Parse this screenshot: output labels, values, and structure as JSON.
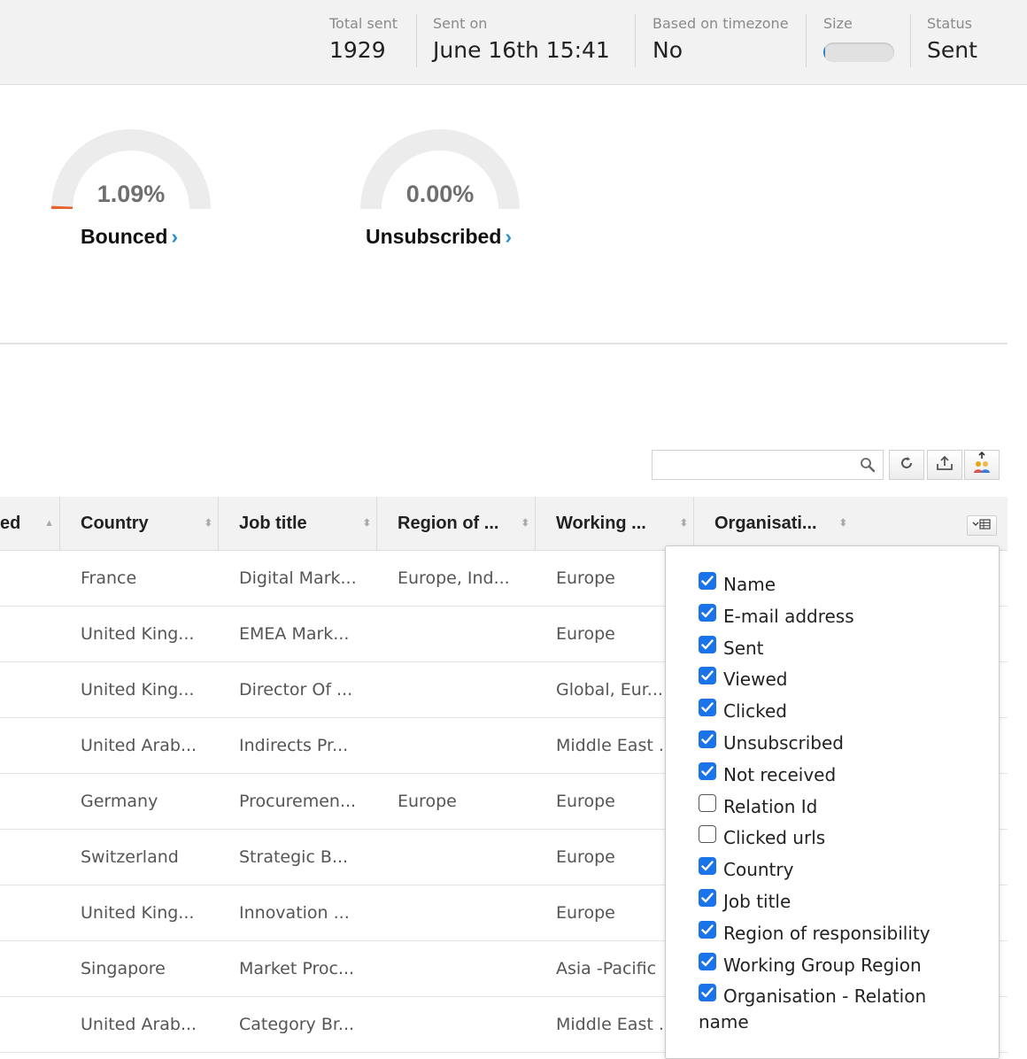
{
  "stats": {
    "total_sent": {
      "label": "Total sent",
      "value": "1929"
    },
    "sent_on": {
      "label": "Sent on",
      "value": "June 16th 15:41"
    },
    "timezone": {
      "label": "Based on timezone",
      "value": "No"
    },
    "size": {
      "label": "Size",
      "fill_fraction": 0.02
    },
    "status": {
      "label": "Status",
      "value": "Sent"
    }
  },
  "gauges": [
    {
      "percent_text": "1.09%",
      "fraction": 0.0109,
      "label": "Bounced",
      "chevron": "›",
      "accent": "#e8622c"
    },
    {
      "percent_text": "0.00%",
      "fraction": 0.0,
      "label": "Unsubscribed",
      "chevron": "›",
      "accent": "#e8622c"
    }
  ],
  "toolbar": {
    "search_value": "",
    "icons": [
      "search-icon",
      "refresh-icon",
      "export-icon",
      "upload-contacts-icon"
    ]
  },
  "table": {
    "columns": [
      "ed",
      "Country",
      "Job title",
      "Region of ...",
      "Working ...",
      "Organisati..."
    ],
    "rows": [
      {
        "country": "France",
        "job": "Digital Mark...",
        "region": "Europe, Ind...",
        "working": "Europe"
      },
      {
        "country": "United King...",
        "job": "EMEA Mark...",
        "region": "",
        "working": "Europe"
      },
      {
        "country": "United King...",
        "job": "Director Of ...",
        "region": "",
        "working": "Global, Eur..."
      },
      {
        "country": "United Arab...",
        "job": "Indirects Pr...",
        "region": "",
        "working": "Middle East ..."
      },
      {
        "country": "Germany",
        "job": "Procuremen...",
        "region": "Europe",
        "working": "Europe"
      },
      {
        "country": "Switzerland",
        "job": "Strategic B...",
        "region": "",
        "working": "Europe"
      },
      {
        "country": "United King...",
        "job": "Innovation ...",
        "region": "",
        "working": "Europe"
      },
      {
        "country": "Singapore",
        "job": "Market Proc...",
        "region": "",
        "working": "Asia -Pacific"
      },
      {
        "country": "United Arab...",
        "job": "Category Br...",
        "region": "",
        "working": "Middle East ..."
      }
    ]
  },
  "column_menu": {
    "options": [
      {
        "label": "Name",
        "checked": true
      },
      {
        "label": "E-mail address",
        "checked": true
      },
      {
        "label": "Sent",
        "checked": true
      },
      {
        "label": "Viewed",
        "checked": true
      },
      {
        "label": "Clicked",
        "checked": true
      },
      {
        "label": "Unsubscribed",
        "checked": true
      },
      {
        "label": "Not received",
        "checked": true
      },
      {
        "label": "Relation Id",
        "checked": false
      },
      {
        "label": "Clicked urls",
        "checked": false
      },
      {
        "label": "Country",
        "checked": true
      },
      {
        "label": "Job title",
        "checked": true
      },
      {
        "label": "Region of responsibility",
        "checked": true
      },
      {
        "label": "Working Group Region",
        "checked": true
      },
      {
        "label": "Organisation - Relation name",
        "checked": true
      }
    ]
  },
  "colors": {
    "checkbox": "#1a73e8",
    "link_chevron": "#2a8fd0",
    "gauge_track": "#ececec",
    "size_fill": "#2d7fc5"
  }
}
